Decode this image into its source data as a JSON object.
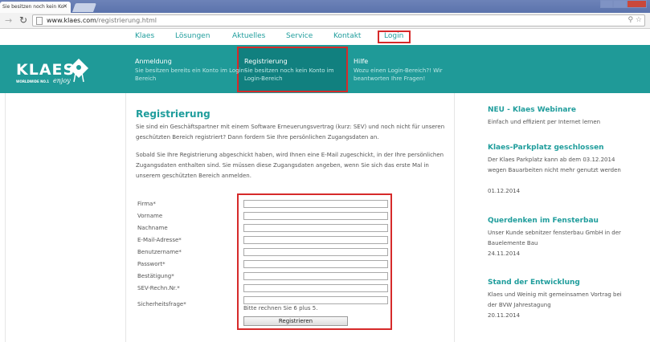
{
  "browser": {
    "tab_title": "Sie besitzen noch kein Ko",
    "tab_close": "✕",
    "url_host": "www.klaes.com",
    "url_path": "/registrierung.html"
  },
  "topnav": {
    "items": [
      "Klaes",
      "Lösungen",
      "Aktuelles",
      "Service",
      "Kontakt",
      "Login"
    ]
  },
  "logo": {
    "name": "KLAES",
    "sub": "WORLDWIDE NO.1",
    "enjoy": "enjoy"
  },
  "subnav": [
    {
      "title": "Anmeldung",
      "desc": "Sie besitzen bereits ein Konto im Login-Bereich"
    },
    {
      "title": "Registrierung",
      "desc": "Sie besitzen noch kein Konto im Login-Bereich"
    },
    {
      "title": "Hilfe",
      "desc": "Wozu einen Login-Bereich?! Wir beantworten Ihre Fragen!"
    }
  ],
  "main": {
    "heading": "Registrierung",
    "para1": "Sie sind ein Geschäftspartner mit einem Software Erneuerungsvertrag (kurz: SEV) und noch nicht für unseren geschützten Bereich registriert? Dann fordern Sie Ihre persönlichen Zugangsdaten an.",
    "para2": "Sobald Sie Ihre Registrierung abgeschickt haben, wird Ihnen eine E-Mail zugeschickt, in der Ihre persönlichen Zugangsdaten enthalten sind. Sie müssen diese Zugangsdaten angeben, wenn Sie sich das erste Mal in unserem geschützten Bereich anmelden."
  },
  "form": {
    "labels": [
      "Firma*",
      "Vorname",
      "Nachname",
      "E-Mail-Adresse*",
      "Benutzername*",
      "Passwort*",
      "Bestätigung*",
      "SEV-Rechn.Nr.*",
      "Sicherheitsfrage*"
    ],
    "captcha_text": "Bitte rechnen Sie 6 plus 5.",
    "submit_label": "Registrieren"
  },
  "sidebar": [
    {
      "title": "NEU - Klaes Webinare",
      "text": "Einfach und effizient per Internet lernen",
      "date": ""
    },
    {
      "title": "Klaes-Parkplatz geschlossen",
      "text": "Der Klaes Parkplatz kann ab dem 03.12.2014 wegen Bauarbeiten nicht mehr genutzt werden",
      "date": "01.12.2014"
    },
    {
      "title": "Querdenken im Fensterbau",
      "text": "Unser Kunde sebnitzer fensterbau GmbH in der Bauelemente Bau",
      "date": "24.11.2014"
    },
    {
      "title": "Stand der Entwicklung",
      "text": "Klaes und Weinig mit gemeinsamen Vortrag bei der BVW Jahrestagung",
      "date": "20.11.2014"
    }
  ],
  "colors": {
    "accent": "#1f9d9c",
    "header_bg": "#1f9a98",
    "highlight": "#d62a2a"
  }
}
